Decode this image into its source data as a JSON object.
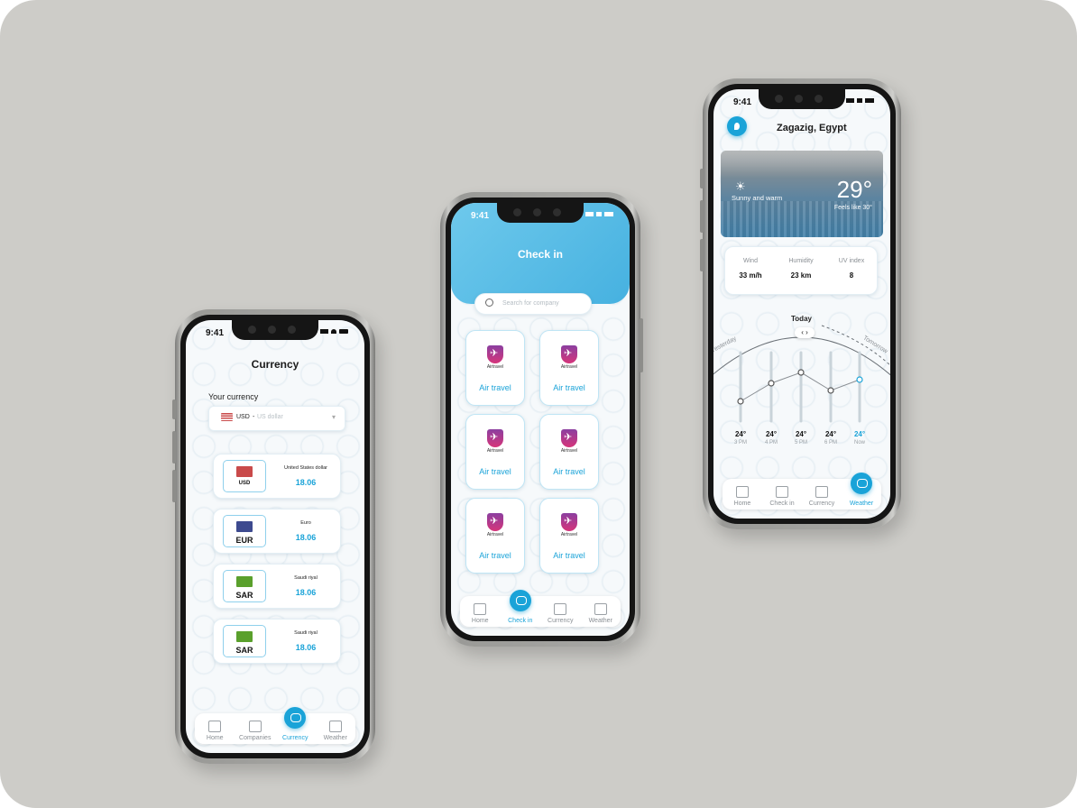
{
  "status_time": "9:41",
  "currency_screen": {
    "title": "Currency",
    "your_currency_label": "Your currency",
    "selector": {
      "code": "USD",
      "name": "US dollar"
    },
    "rows": [
      {
        "code": "USD",
        "name": "United States dollar",
        "value": "18.06",
        "flag_color": "#c94a4a"
      },
      {
        "code": "EUR",
        "name": "Euro",
        "value": "18.06",
        "flag_color": "#3d4a8f"
      },
      {
        "code": "SAR",
        "name": "Saudi riyal",
        "value": "18.06",
        "flag_color": "#5aa02c"
      },
      {
        "code": "SAR",
        "name": "Saudi riyal",
        "value": "18.06",
        "flag_color": "#5aa02c"
      }
    ],
    "nav": [
      {
        "label": "Home",
        "icon": "home-icon"
      },
      {
        "label": "Companies",
        "icon": "companies-icon"
      },
      {
        "label": "Currency",
        "icon": "currency-icon",
        "active": true
      },
      {
        "label": "Weather",
        "icon": "cloud-icon"
      }
    ]
  },
  "checkin_screen": {
    "title": "Check in",
    "search_placeholder": "Search for company",
    "companies": [
      {
        "name": "Air travel",
        "logo_text": "Airtravel"
      },
      {
        "name": "Air travel",
        "logo_text": "Airtravel"
      },
      {
        "name": "Air travel",
        "logo_text": "Airtravel"
      },
      {
        "name": "Air travel",
        "logo_text": "Airtravel"
      },
      {
        "name": "Air travel",
        "logo_text": "Airtravel"
      },
      {
        "name": "Air travel",
        "logo_text": "Airtravel"
      }
    ],
    "nav": [
      {
        "label": "Home",
        "icon": "home-icon"
      },
      {
        "label": "Check in",
        "icon": "checkin-icon",
        "active": true
      },
      {
        "label": "Currency",
        "icon": "currency-icon"
      },
      {
        "label": "Weather",
        "icon": "cloud-icon"
      }
    ]
  },
  "weather_screen": {
    "location": "Zagazig, Egypt",
    "hero": {
      "condition": "Sunny and warm",
      "temp": "29°",
      "feels_like": "Feels like 30°"
    },
    "stats": [
      {
        "label": "Wind",
        "value": "33 m/h"
      },
      {
        "label": "Humidity",
        "value": "23 km"
      },
      {
        "label": "UV index",
        "value": "8"
      }
    ],
    "day_label": "Today",
    "yesterday_label": "Yesterday",
    "tomorrow_label": "Tomorrow",
    "hourly": [
      {
        "temp": "24°",
        "time": "3 PM"
      },
      {
        "temp": "24°",
        "time": "4 PM"
      },
      {
        "temp": "24°",
        "time": "5 PM"
      },
      {
        "temp": "24°",
        "time": "6 PM"
      },
      {
        "temp": "24°",
        "time": "Now"
      }
    ],
    "nav": [
      {
        "label": "Home",
        "icon": "home-icon"
      },
      {
        "label": "Check in",
        "icon": "checkin-icon"
      },
      {
        "label": "Currency",
        "icon": "currency-icon"
      },
      {
        "label": "Weather",
        "icon": "cloud-icon",
        "active": true
      }
    ]
  },
  "colors": {
    "accent": "#1aa3d8",
    "background": "#cdccc8"
  }
}
